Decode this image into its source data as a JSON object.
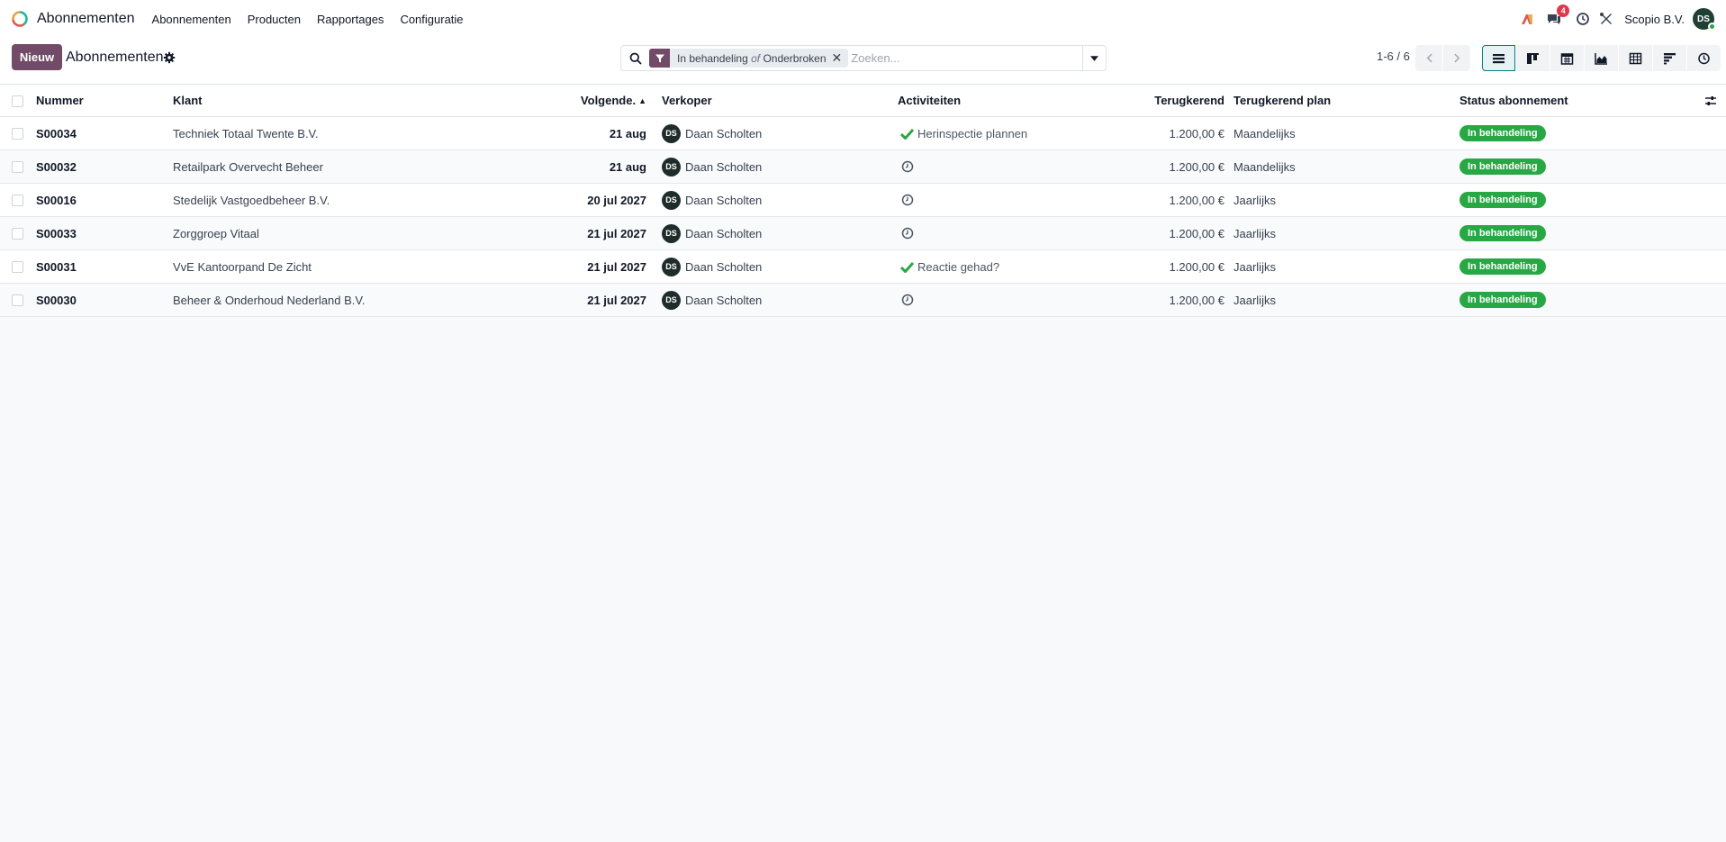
{
  "navbar": {
    "app_name": "Abonnementen",
    "menu": [
      "Abonnementen",
      "Producten",
      "Rapportages",
      "Configuratie"
    ],
    "messages_count": "4",
    "company": "Scopio B.V.",
    "user_initials": "DS"
  },
  "control": {
    "new_label": "Nieuw",
    "title": "Abonnementen",
    "facet": {
      "part1": "In behandeling",
      "sep": "of",
      "part2": "Onderbroken"
    },
    "search_placeholder": "Zoeken...",
    "pager": "1-6 / 6",
    "views": [
      "list-view-icon",
      "kanban-view-icon",
      "calendar-view-icon",
      "graph-view-icon",
      "pivot-view-icon",
      "cohort-view-icon",
      "activity-view-icon"
    ]
  },
  "table": {
    "columns": {
      "nummer": "Nummer",
      "klant": "Klant",
      "volgende": "Volgende.",
      "verkoper": "Verkoper",
      "activiteiten": "Activiteiten",
      "terugkerend": "Terugkerend",
      "plan": "Terugkerend plan",
      "status": "Status abonnement"
    },
    "rows": [
      {
        "nummer": "S00034",
        "klant": "Techniek Totaal Twente B.V.",
        "datum": "21 aug",
        "verkoper_initials": "DS",
        "verkoper": "Daan Scholten",
        "activiteit": "Herinspectie plannen",
        "bedrag": "1.200,00 €",
        "plan": "Maandelijks",
        "status": "In behandeling"
      },
      {
        "nummer": "S00032",
        "klant": "Retailpark Overvecht Beheer",
        "datum": "21 aug",
        "verkoper_initials": "DS",
        "verkoper": "Daan Scholten",
        "activiteit": "",
        "bedrag": "1.200,00 €",
        "plan": "Maandelijks",
        "status": "In behandeling"
      },
      {
        "nummer": "S00016",
        "klant": "Stedelijk Vastgoedbeheer B.V.",
        "datum": "20 jul 2027",
        "verkoper_initials": "DS",
        "verkoper": "Daan Scholten",
        "activiteit": "",
        "bedrag": "1.200,00 €",
        "plan": "Jaarlijks",
        "status": "In behandeling"
      },
      {
        "nummer": "S00033",
        "klant": "Zorggroep Vitaal",
        "datum": "21 jul 2027",
        "verkoper_initials": "DS",
        "verkoper": "Daan Scholten",
        "activiteit": "",
        "bedrag": "1.200,00 €",
        "plan": "Jaarlijks",
        "status": "In behandeling"
      },
      {
        "nummer": "S00031",
        "klant": "VvE Kantoorpand De Zicht",
        "datum": "21 jul 2027",
        "verkoper_initials": "DS",
        "verkoper": "Daan Scholten",
        "activiteit": "Reactie gehad?",
        "bedrag": "1.200,00 €",
        "plan": "Jaarlijks",
        "status": "In behandeling"
      },
      {
        "nummer": "S00030",
        "klant": "Beheer & Onderhoud Nederland B.V.",
        "datum": "21 jul 2027",
        "verkoper_initials": "DS",
        "verkoper": "Daan Scholten",
        "activiteit": "",
        "bedrag": "1.200,00 €",
        "plan": "Jaarlijks",
        "status": "In behandeling"
      }
    ]
  },
  "colors": {
    "brand": "#714b67",
    "status_green": "#28a745",
    "active_view": "#017e84"
  }
}
